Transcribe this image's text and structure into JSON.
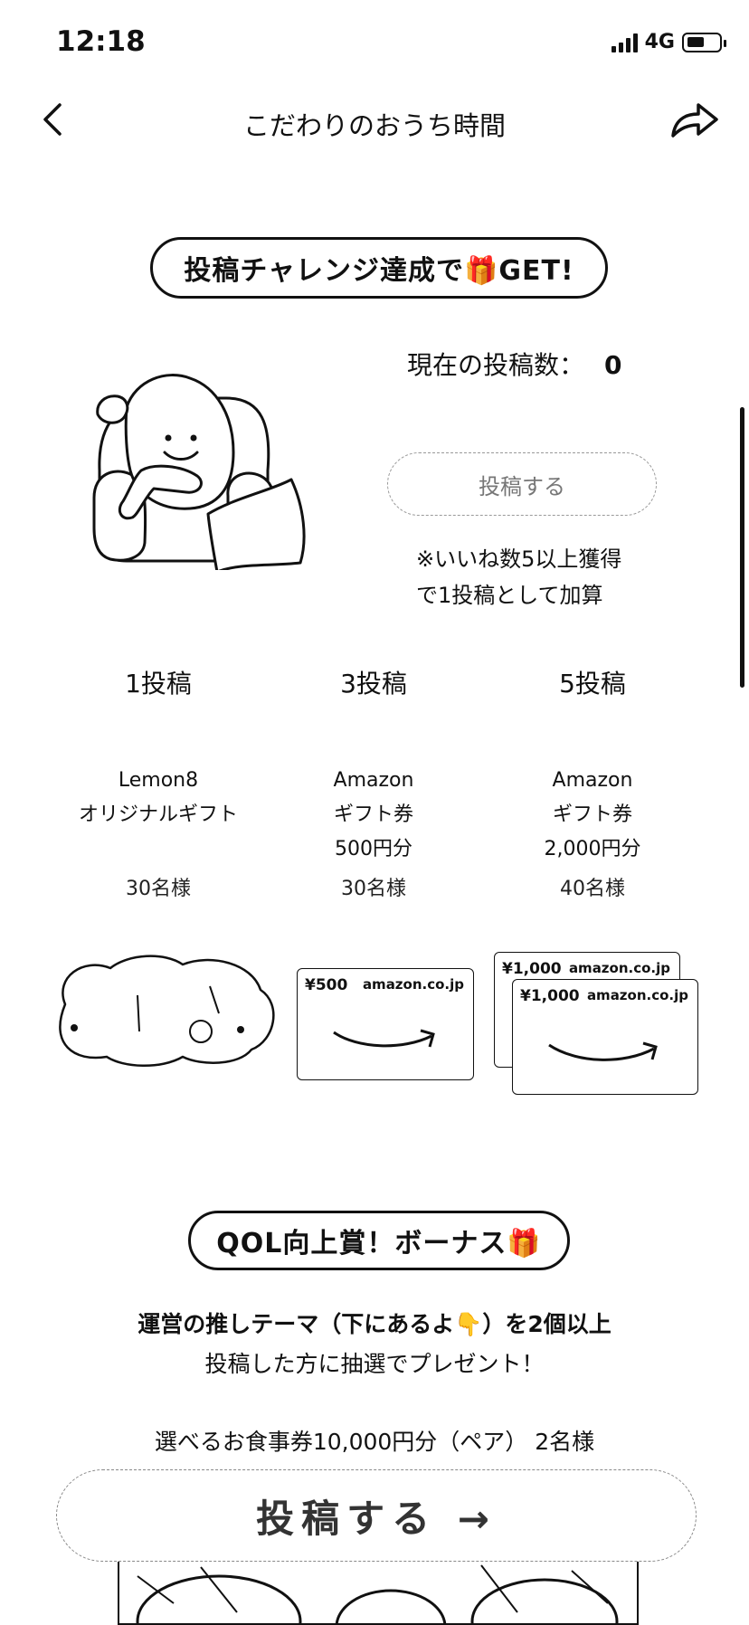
{
  "status": {
    "time": "12:18",
    "network": "4G"
  },
  "header": {
    "title": "こだわりのおうち時間"
  },
  "challenge": {
    "heading": "投稿チャレンジ達成で🎁GET!",
    "count_label": "現在の投稿数：",
    "count_value": "0",
    "post_button": "投稿する",
    "note_line1": "※いいね数5以上獲得",
    "note_line2": "で1投稿として加算"
  },
  "tiers": [
    {
      "title": "1投稿",
      "line1": "Lemon8",
      "line2": "オリジナルギフト",
      "line3": "",
      "winners": "30名様"
    },
    {
      "title": "3投稿",
      "line1": "Amazon",
      "line2": "ギフト券",
      "line3": "500円分",
      "winners": "30名様"
    },
    {
      "title": "5投稿",
      "line1": "Amazon",
      "line2": "ギフト券",
      "line3": "2,000円分",
      "winners": "40名様"
    }
  ],
  "cards": {
    "card500_amount": "¥500",
    "card1000_amount": "¥1,000",
    "brand": "amazon.co.jp"
  },
  "bonus": {
    "heading": "QOL向上賞！ボーナス🎁",
    "line1": "運営の推しテーマ（下にあるよ👇）を2個以上",
    "line2": "投稿した方に抽選でプレゼント！",
    "prize": "選べるお食事券10,000円分（ペア） 2名様"
  },
  "bottom": {
    "post_button": "投稿する →"
  }
}
